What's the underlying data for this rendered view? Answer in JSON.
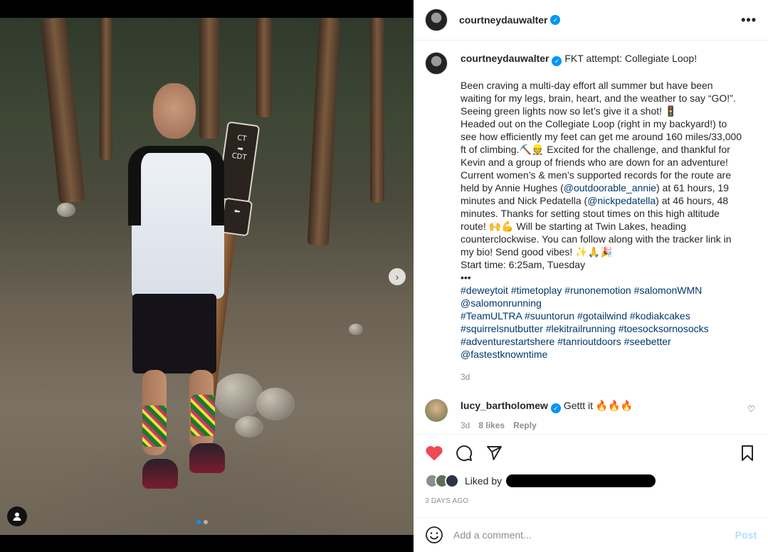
{
  "post": {
    "username": "courtneydauwalter",
    "verified_mark": "✓",
    "more_icon": "•••"
  },
  "caption": {
    "username": "courtneydauwalter",
    "title": "FKT attempt: Collegiate Loop!",
    "p1": "Been craving a multi-day effort all summer but have been waiting for my legs, brain, heart, and the weather to say “GO!”. Seeing green lights now so let’s give it a shot! 🚦",
    "p2a": "Headed out on the Collegiate Loop (right in my backyard!) to see how efficiently my feet can get me around 160 miles/33,000 ft of climbing.⛏️👷 Excited for the challenge, and thankful for Kevin and a group of friends who are down for an adventure! Current women’s & men’s supported records for the route are held by Annie Hughes (",
    "mention1": "@outdoorable_annie",
    "p2b": ") at 61 hours, 19 minutes and Nick Pedatella (",
    "mention2": "@nickpedatella",
    "p2c": ") at 46 hours, 48 minutes. Thanks for setting stout times on this high altitude route! 🙌💪 Will be starting at Twin Lakes, heading counterclockwise. You can follow along with the tracker link in my bio! Send good vibes! ✨🙏🎉",
    "start_time": "Start time: 6:25am, Tuesday",
    "ellipsis": "•••",
    "tags1": "#deweytoit #timetoplay #runonemotion #salomonWMN",
    "tags2": "@salomonrunning",
    "tags3": "#TeamULTRA #suuntorun #gotailwind #kodiakcakes",
    "tags4": "#squirrelsnutbutter #lekitrailrunning #toesocksornosocks",
    "tags5": "#adventurestartshere #tanrioutdoors #seebetter",
    "tags6": "@fastestknowntime",
    "age": "3d"
  },
  "comment": {
    "username": "lucy_bartholomew",
    "text": "Gettt it 🔥🔥🔥",
    "age": "3d",
    "likes": "8 likes",
    "reply": "Reply",
    "heart_icon": "♡"
  },
  "actions": {
    "liked_by_label": "Liked by",
    "time_ago": "3 DAYS AGO"
  },
  "add_comment": {
    "placeholder": "Add a comment...",
    "post_label": "Post"
  },
  "media": {
    "next_icon": "›",
    "sign_top": "CT",
    "sign_mid": "CDT"
  },
  "colors": {
    "like_red": "#ed4956",
    "link_blue": "#00376b",
    "verified_blue": "#0095f6"
  }
}
